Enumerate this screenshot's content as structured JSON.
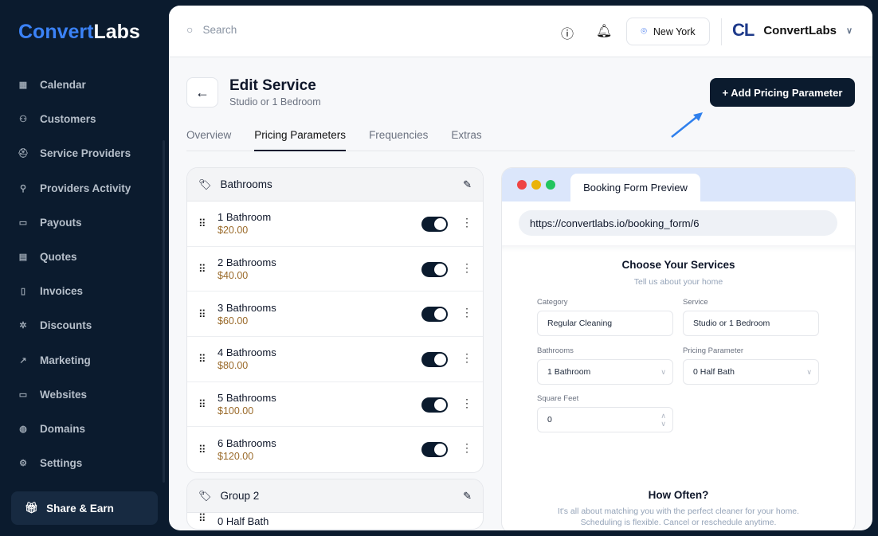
{
  "sidebar": {
    "logo_a": "Convert",
    "logo_b": "Labs",
    "items": [
      {
        "label": "Calendar",
        "icon": "calendar-icon"
      },
      {
        "label": "Customers",
        "icon": "users-icon"
      },
      {
        "label": "Service Providers",
        "icon": "provider-icon"
      },
      {
        "label": "Providers Activity",
        "icon": "user-gear-icon"
      },
      {
        "label": "Payouts",
        "icon": "card-icon"
      },
      {
        "label": "Quotes",
        "icon": "scroll-icon"
      },
      {
        "label": "Invoices",
        "icon": "file-icon"
      },
      {
        "label": "Discounts",
        "icon": "discount-icon"
      },
      {
        "label": "Marketing",
        "icon": "trend-icon"
      },
      {
        "label": "Websites",
        "icon": "laptop-icon"
      },
      {
        "label": "Domains",
        "icon": "globe-icon"
      },
      {
        "label": "Settings",
        "icon": "gear-icon"
      }
    ],
    "share": "Share & Earn"
  },
  "topbar": {
    "search_placeholder": "Search",
    "location": "New York",
    "brand_mark": "CL",
    "brand": "ConvertLabs"
  },
  "header": {
    "title": "Edit Service",
    "subtitle": "Studio or 1 Bedroom",
    "add_button": "+ Add Pricing Parameter"
  },
  "tabs": [
    "Overview",
    "Pricing Parameters",
    "Frequencies",
    "Extras"
  ],
  "groups": [
    {
      "name": "Bathrooms",
      "items": [
        {
          "name": "1 Bathroom",
          "price": "$20.00"
        },
        {
          "name": "2 Bathrooms",
          "price": "$40.00"
        },
        {
          "name": "3 Bathrooms",
          "price": "$60.00"
        },
        {
          "name": "4 Bathrooms",
          "price": "$80.00"
        },
        {
          "name": "5 Bathrooms",
          "price": "$100.00"
        },
        {
          "name": "6 Bathrooms",
          "price": "$120.00"
        }
      ]
    },
    {
      "name": "Group 2",
      "items": [
        {
          "name": "0 Half Bath"
        }
      ]
    }
  ],
  "preview": {
    "tab": "Booking Form Preview",
    "url": "https://convertlabs.io/booking_form/6",
    "title": "Choose Your Services",
    "subtitle": "Tell us about your home",
    "category_label": "Category",
    "category": "Regular Cleaning",
    "service_label": "Service",
    "service": "Studio or 1 Bedroom",
    "bathrooms_label": "Bathrooms",
    "bathrooms": "1 Bathroom",
    "param_label": "Pricing Parameter",
    "param": "0 Half Bath",
    "sqft_label": "Square Feet",
    "sqft": "0",
    "how_title": "How Often?",
    "how_sub1": "It's all about matching you with the perfect cleaner for your home.",
    "how_sub2": "Scheduling is flexible. Cancel or reschedule anytime."
  }
}
